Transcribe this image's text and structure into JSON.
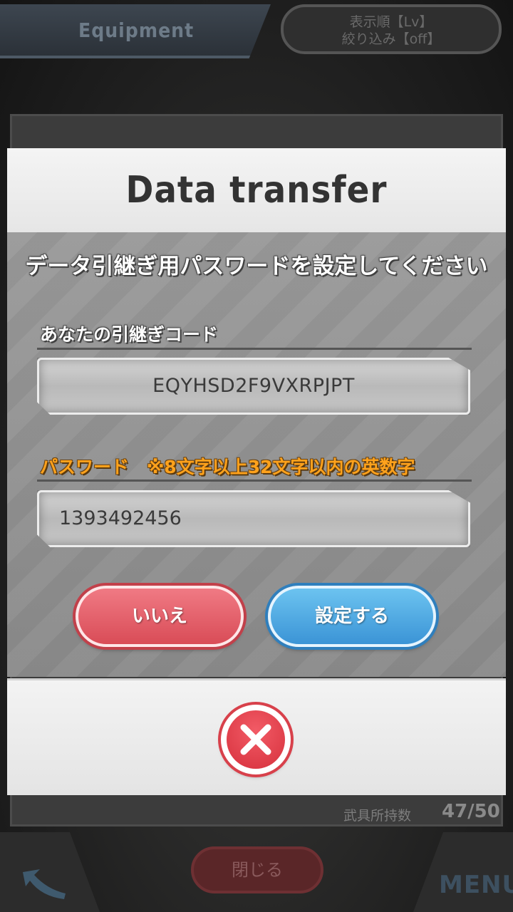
{
  "background": {
    "tab_title": "Equipment",
    "sort_line1": "表示順【Lv】",
    "sort_line2": "絞り込み【off】",
    "weapon_count_label": "武具所持数",
    "weapon_count": "47/50",
    "close_label": "閉じる",
    "menu_label": "MENU"
  },
  "dialog": {
    "title": "Data transfer",
    "instruction": "データ引継ぎ用パスワードを設定してください",
    "code_label": "あなたの引継ぎコード",
    "code_value": "EQYHSD2F9VXRPJPT",
    "password_label": "パスワード　※8文字以上32文字以内の英数字",
    "password_value": "1393492456",
    "no_button": "いいえ",
    "set_button": "設定する"
  },
  "colors": {
    "accent_orange": "#ffa21c",
    "no_button": "#e25762",
    "set_button": "#4aa3e0",
    "close_button": "#d8414b"
  },
  "icons": [
    "back-arrow-icon",
    "close-x-icon"
  ]
}
